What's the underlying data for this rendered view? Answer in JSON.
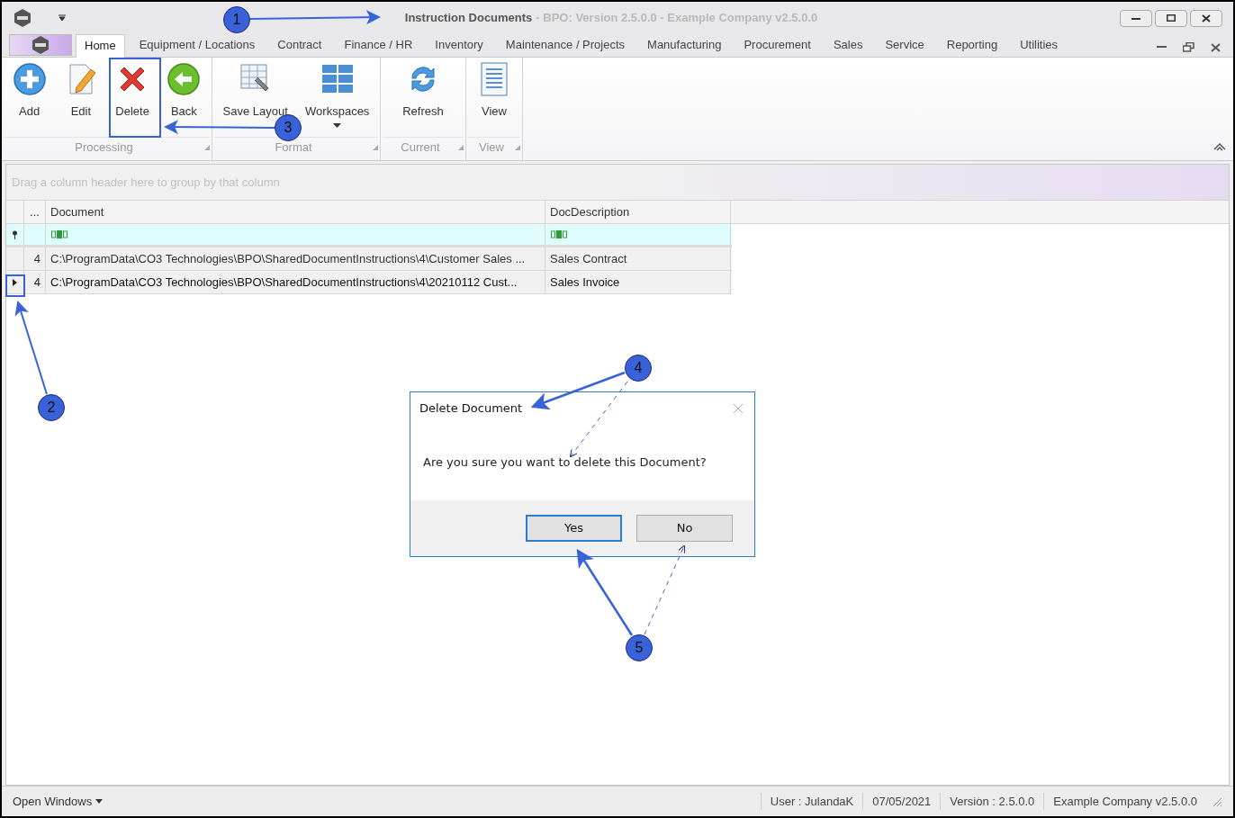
{
  "window": {
    "title": "Instruction Documents",
    "title_suffix": "- BPO: Version 2.5.0.0 - Example Company v2.5.0.0"
  },
  "menu_tabs": [
    {
      "label": "Home",
      "selected": true
    },
    {
      "label": "Equipment / Locations",
      "selected": false
    },
    {
      "label": "Contract",
      "selected": false
    },
    {
      "label": "Finance / HR",
      "selected": false
    },
    {
      "label": "Inventory",
      "selected": false
    },
    {
      "label": "Maintenance / Projects",
      "selected": false
    },
    {
      "label": "Manufacturing",
      "selected": false
    },
    {
      "label": "Procurement",
      "selected": false
    },
    {
      "label": "Sales",
      "selected": false
    },
    {
      "label": "Service",
      "selected": false
    },
    {
      "label": "Reporting",
      "selected": false
    },
    {
      "label": "Utilities",
      "selected": false
    }
  ],
  "ribbon": [
    {
      "label": "Processing",
      "buttons": [
        {
          "label": "Add",
          "kind": "add",
          "dropdown": false
        },
        {
          "label": "Edit",
          "kind": "edit",
          "dropdown": false
        },
        {
          "label": "Delete",
          "kind": "delete",
          "dropdown": false
        },
        {
          "label": "Back",
          "kind": "back",
          "dropdown": false
        }
      ]
    },
    {
      "label": "Format",
      "buttons": [
        {
          "label": "Save Layout",
          "kind": "layout",
          "dropdown": false
        },
        {
          "label": "Workspaces",
          "kind": "workspaces",
          "dropdown": true
        }
      ]
    },
    {
      "label": "Current",
      "buttons": [
        {
          "label": "Refresh",
          "kind": "refresh",
          "dropdown": false
        }
      ]
    },
    {
      "label": "View",
      "buttons": [
        {
          "label": "View",
          "kind": "view",
          "dropdown": false
        }
      ]
    }
  ],
  "grid": {
    "group_panel_hint": "Drag a column header here to group by that column",
    "columns": [
      "...",
      "Document",
      "DocDescription"
    ],
    "rows": [
      {
        "cells": [
          "4",
          "C:\\ProgramData\\CO3 Technologies\\BPO\\SharedDocumentInstructions\\4\\Customer Sales ...",
          "Sales Contract"
        ],
        "selected": false
      },
      {
        "cells": [
          "4",
          "C:\\ProgramData\\CO3 Technologies\\BPO\\SharedDocumentInstructions\\4\\20210112 Cust...",
          "Sales Invoice"
        ],
        "selected": true
      }
    ]
  },
  "dialog": {
    "title": "Delete Document",
    "message": "Are you sure you want to delete this Document?",
    "buttons": [
      {
        "label": "Yes",
        "selected": true
      },
      {
        "label": "No",
        "selected": false
      }
    ]
  },
  "status_bar": {
    "open_windows": "Open Windows",
    "items": [
      "User : JulandaK",
      "07/05/2021",
      "Version : 2.5.0.0",
      "Example Company v2.5.0.0"
    ]
  },
  "callouts": [
    {
      "number": "1"
    },
    {
      "number": "2"
    },
    {
      "number": "3"
    },
    {
      "number": "4"
    },
    {
      "number": "5"
    }
  ]
}
